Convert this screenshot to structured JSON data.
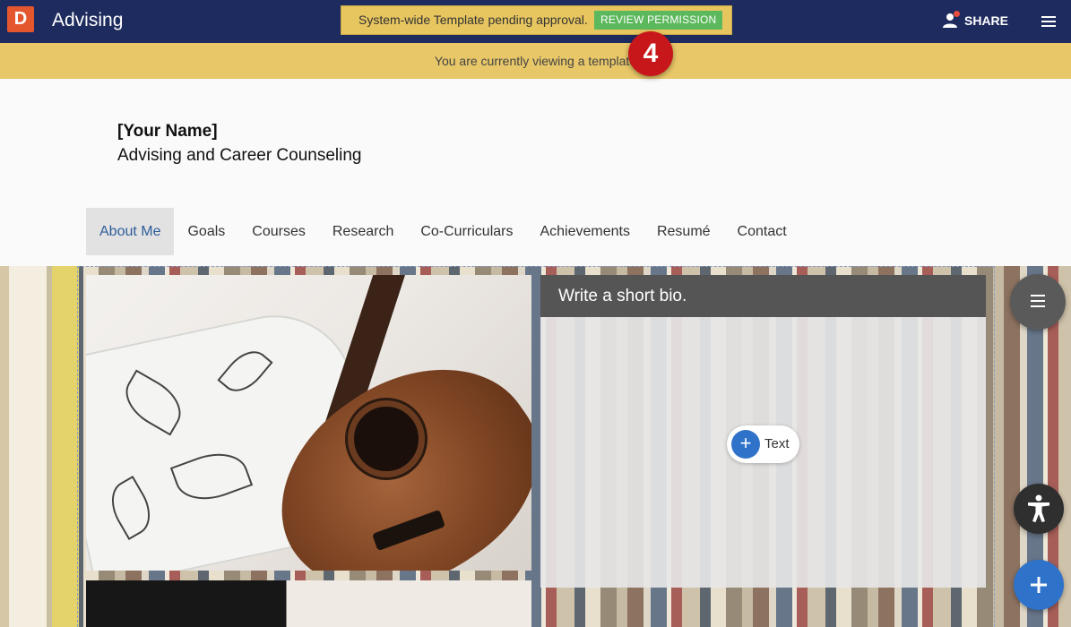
{
  "app": {
    "logo_letter": "D",
    "title": "Advising"
  },
  "banner": {
    "pending_text": "System-wide Template pending approval.",
    "review_button": "REVIEW PERMISSION",
    "notice_text": "You are currently viewing a template",
    "badge_number": "4"
  },
  "header_actions": {
    "share_label": "SHARE"
  },
  "profile": {
    "name": "[Your Name]",
    "subtitle": "Advising and Career Counseling"
  },
  "nav": {
    "items": [
      "About Me",
      "Goals",
      "Courses",
      "Research",
      "Co-Curriculars",
      "Achievements",
      "Resumé",
      "Contact"
    ],
    "active": "About Me"
  },
  "bio": {
    "heading": "Write a short bio.",
    "add_text_label": "Text"
  },
  "colors": {
    "topbar": "#1e2b5e",
    "notice": "#e8c768",
    "badge": "#c8171a",
    "review": "#5cb85c",
    "accent": "#2f72c9"
  }
}
